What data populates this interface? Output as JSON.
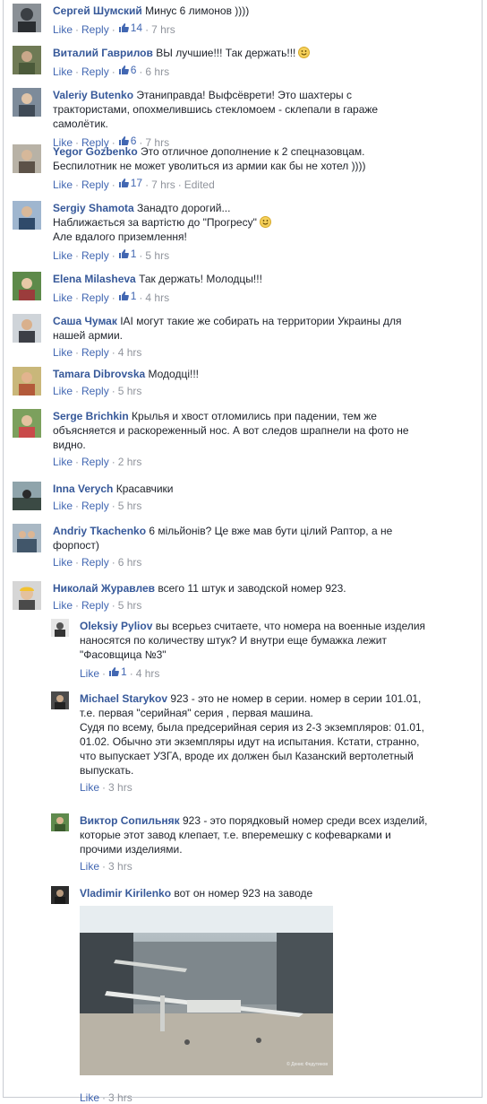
{
  "comments": [
    {
      "author": "Сергей Шумский",
      "text": "Минус 6 лимонов ))))",
      "likes": "14",
      "time": "7 hrs",
      "edited": ""
    },
    {
      "author": "Виталий Гаврилов",
      "text": "ВЫ лучшие!!! Так держать!!!",
      "likes": "6",
      "time": "6 hrs",
      "edited": ""
    },
    {
      "author": "Valeriy Butenko",
      "text": "Этаниправда! Выфсёврети! Это шахтеры с трактористами, опохмелившись стекломоем - склепали в гараже самолётик.",
      "likes": "6",
      "time": "7 hrs",
      "edited": ""
    },
    {
      "author": "Yegor Gozbenko",
      "text": "Это отличное дополнение к 2 спецназовцам. Беспилотник не может уволиться из армии как бы не хотел ))))",
      "likes": "17",
      "time": "7 hrs",
      "edited": "Edited"
    },
    {
      "author": "Sergiy Shamota",
      "text": "Занадто дорогий...",
      "text2": "Наближається за вартістю до \"Прогресу\"",
      "text3": "Але вдалого приземлення!",
      "likes": "1",
      "time": "5 hrs",
      "edited": ""
    },
    {
      "author": "Elena Milasheva",
      "text": "Так держать! Молодцы!!!",
      "likes": "1",
      "time": "4 hrs",
      "edited": ""
    },
    {
      "author": "Саша Чумак",
      "text": "IAI могут такие же собирать на территории Украины для нашей армии.",
      "likes": "",
      "time": "4 hrs",
      "edited": ""
    },
    {
      "author": "Tamara Dibrovska",
      "text": "Мододці!!!",
      "likes": "",
      "time": "5 hrs",
      "edited": ""
    },
    {
      "author": "Serge Brichkin",
      "text": "Крылья и хвост отломились при падении, тем же объясняется и раскореженный нос. А вот следов шрапнели на фото не видно.",
      "likes": "",
      "time": "2 hrs",
      "edited": ""
    },
    {
      "author": "Inna Verych",
      "text": "Красавчики",
      "likes": "",
      "time": "5 hrs",
      "edited": ""
    },
    {
      "author": "Andriy Tkachenko",
      "text": "6 мільйонів? Це вже мав бути цілий Раптор, а не форпост)",
      "likes": "",
      "time": "6 hrs",
      "edited": ""
    },
    {
      "author": "Николай Журавлев",
      "text": "всего 11 штук и заводской номер 923.",
      "likes": "",
      "time": "5 hrs",
      "edited": ""
    }
  ],
  "replies": [
    {
      "author": "Oleksiy Pyliov",
      "text": "вы всерьез считаете, что номера на военные изделия наносятся по количеству штук? И внутри еще бумажка лежит \"Фасовщица №3\"",
      "likes": "1",
      "time": "4 hrs"
    },
    {
      "author": "Michael Starykov",
      "text": "923 - это не номер в серии. номер в серии 101.01, т.е. первая \"серийная\" серия , первая машина.",
      "text2": "Судя по всему, была предсерийная серия из 2-3 экземпляров: 01.01, 01.02. Обычно эти экземпляры идут на испытания. Кстати, странно, что выпускает УЗГА, вроде их должен был Казанский вертолетный выпускать.",
      "likes": "",
      "time": "3 hrs"
    },
    {
      "author": "Виктор Сопильняк",
      "text": "923 - это порядковый номер среди всех изделий, которые этот завод клепает, т.е. вперемешку с кофеварками и прочими изделиями.",
      "likes": "",
      "time": "3 hrs"
    },
    {
      "author": "Vladimir Kirilenko",
      "text": "вот он номер 923 на заводе",
      "likes": "",
      "time": "3 hrs",
      "photo_credit": "© Денис Федутинов"
    }
  ],
  "labels": {
    "like": "Like",
    "reply": "Reply",
    "dot": "·"
  },
  "colors": {
    "link": "#365899",
    "action": "#4267b2",
    "meta": "#90949c"
  }
}
